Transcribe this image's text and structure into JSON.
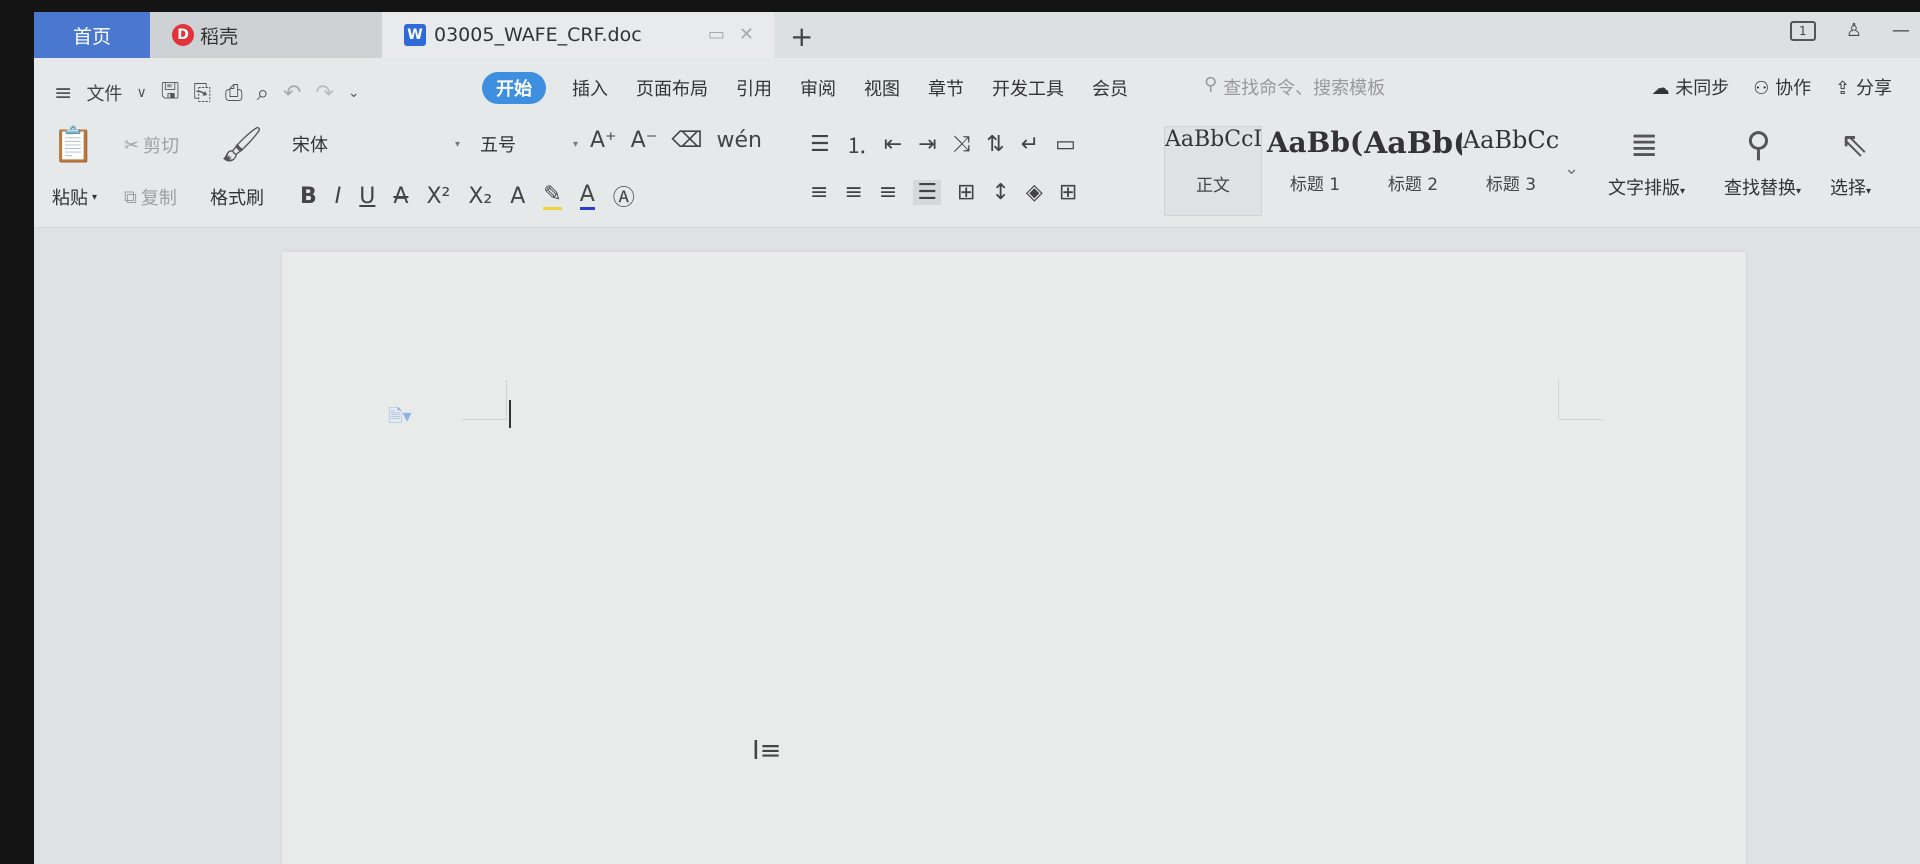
{
  "titlebar": {
    "home_tab": "首页",
    "daoke_tab": "稻壳",
    "doc_tab": "03005_WAFE_CRF.doc",
    "new_tab": "+",
    "window_num": "1"
  },
  "menu": {
    "file": "文件",
    "tabs": [
      "开始",
      "插入",
      "页面布局",
      "引用",
      "审阅",
      "视图",
      "章节",
      "开发工具",
      "会员"
    ],
    "active_tab": "开始",
    "search_placeholder": "查找命令、搜索模板",
    "right": [
      "未同步",
      "协作",
      "分享"
    ]
  },
  "ribbon": {
    "paste": "粘贴",
    "cut": "剪切",
    "copy": "复制",
    "format_painter": "格式刷",
    "font_name": "宋体",
    "font_size": "五号",
    "styles": [
      {
        "sample": "AaBbCcDd",
        "name": "正文"
      },
      {
        "sample": "AaBb(",
        "name": "标题 1"
      },
      {
        "sample": "AaBb(",
        "name": "标题 2"
      },
      {
        "sample": "AaBbCc",
        "name": "标题 3"
      }
    ],
    "text_layout": "文字排版",
    "find_replace": "查找替换",
    "select": "选择"
  },
  "accent_color": "#3f8fe0",
  "home_tab_color": "#4a78d0"
}
